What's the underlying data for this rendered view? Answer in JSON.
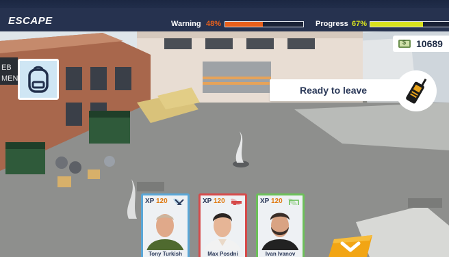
{
  "hud": {
    "title": "ESCAPE",
    "warning": {
      "label": "Warning",
      "value_text": "48%",
      "value": 0.48,
      "color": "#e8601c"
    },
    "progress": {
      "label": "Progress",
      "value_text": "67%",
      "value": 0.67,
      "color": "#d9e21e"
    }
  },
  "money": {
    "value": "10689",
    "icon": "dollar-bill-icon"
  },
  "inventory": {
    "icon": "backpack-icon"
  },
  "action": {
    "label": "Ready to leave",
    "icon": "walkie-talkie-icon"
  },
  "crew": [
    {
      "xp_label": "XP",
      "xp": "120",
      "name": "Tony Turkish",
      "role_icon": "tools-icon",
      "accent": "#5aa6d6"
    },
    {
      "xp_label": "XP",
      "xp": "120",
      "name": "Max Posdni",
      "role_icon": "pistol-icon",
      "accent": "#d64a4a"
    },
    {
      "xp_label": "XP",
      "xp": "120",
      "name": "Ivan Ivanov",
      "role_icon": "cash-icon",
      "accent": "#6cc05a"
    }
  ],
  "confirm": {
    "icon": "chevron-down-icon"
  }
}
